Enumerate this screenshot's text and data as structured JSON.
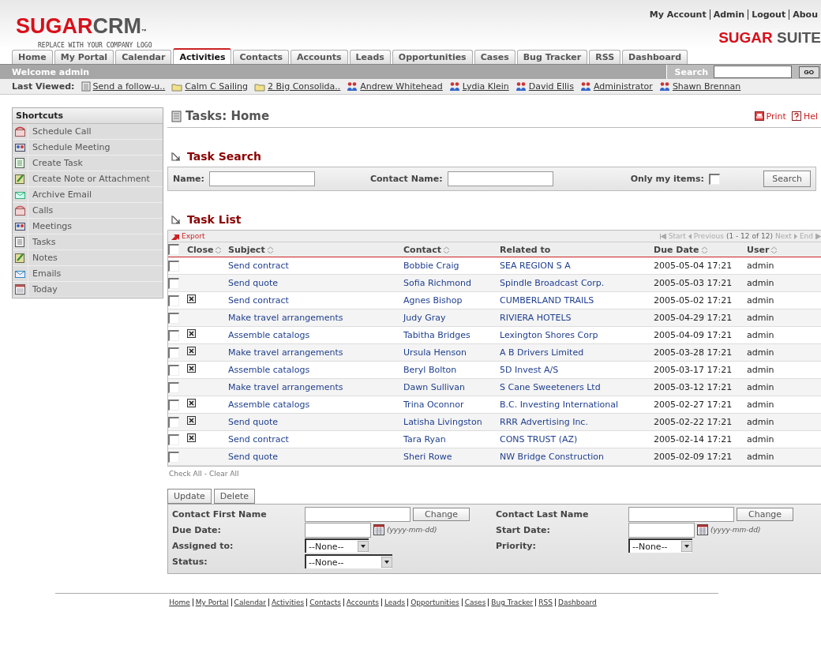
{
  "header": {
    "logo_main": "SUGAR",
    "logo_accent": "CRM",
    "logo_tm": "™",
    "logo_tagline": "REPLACE WITH YOUR COMPANY LOGO",
    "top_links": [
      "My Account",
      "Admin",
      "Logout",
      "Abou"
    ],
    "suite_logo_main": "SUGAR",
    "suite_logo_accent": "SUITE"
  },
  "tabs": [
    {
      "label": "Home",
      "selected": false
    },
    {
      "label": "My Portal",
      "selected": false
    },
    {
      "label": "Calendar",
      "selected": false
    },
    {
      "label": "Activities",
      "selected": true
    },
    {
      "label": "Contacts",
      "selected": false
    },
    {
      "label": "Accounts",
      "selected": false
    },
    {
      "label": "Leads",
      "selected": false
    },
    {
      "label": "Opportunities",
      "selected": false
    },
    {
      "label": "Cases",
      "selected": false
    },
    {
      "label": "Bug Tracker",
      "selected": false
    },
    {
      "label": "RSS",
      "selected": false
    },
    {
      "label": "Dashboard",
      "selected": false
    }
  ],
  "welcome_bar": {
    "text": "Welcome admin",
    "search_label": "Search",
    "go_button": "GO"
  },
  "last_viewed": {
    "label": "Last Viewed:",
    "items": [
      {
        "label": "Send a follow-u..",
        "kind": "task"
      },
      {
        "label": "Calm C Sailing",
        "kind": "account"
      },
      {
        "label": "2 Big Consolida..",
        "kind": "account"
      },
      {
        "label": "Andrew Whitehead",
        "kind": "contact"
      },
      {
        "label": "Lydia Klein",
        "kind": "contact"
      },
      {
        "label": "David Ellis",
        "kind": "contact"
      },
      {
        "label": "Administrator",
        "kind": "contact"
      },
      {
        "label": "Shawn Brennan",
        "kind": "contact"
      }
    ]
  },
  "sidebar": {
    "title": "Shortcuts",
    "items": [
      {
        "label": "Schedule Call",
        "kind": "call-new"
      },
      {
        "label": "Schedule Meeting",
        "kind": "meeting"
      },
      {
        "label": "Create Task",
        "kind": "task-new"
      },
      {
        "label": "Create Note or Attachment",
        "kind": "note"
      },
      {
        "label": "Archive Email",
        "kind": "email-new"
      },
      {
        "label": "Calls",
        "kind": "call"
      },
      {
        "label": "Meetings",
        "kind": "meeting"
      },
      {
        "label": "Tasks",
        "kind": "task"
      },
      {
        "label": "Notes",
        "kind": "note"
      },
      {
        "label": "Emails",
        "kind": "email"
      },
      {
        "label": "Today",
        "kind": "calendar"
      }
    ]
  },
  "page_title": "Tasks: Home",
  "print_link": "Print",
  "help_link": "Hel",
  "task_search": {
    "title": "Task Search",
    "name_label": "Name:",
    "contact_label": "Contact Name:",
    "only_mine_label": "Only my items:",
    "only_mine_checked": false,
    "search_button": "Search"
  },
  "task_list": {
    "title": "Task List",
    "export": "Export",
    "pagination": {
      "start": "Start",
      "previous": "Previous",
      "range": "(1 - 12 of 12)",
      "next": "Next",
      "end": "End"
    },
    "select_all_checked": false,
    "columns": [
      "Close",
      "Subject",
      "Contact",
      "Related to",
      "Due Date",
      "User"
    ],
    "rows": [
      {
        "checked": false,
        "closed": false,
        "subject": "Send contract",
        "contact": "Bobbie Craig",
        "related": "SEA REGION S A",
        "due": "2005-05-04 17:21",
        "user": "admin"
      },
      {
        "checked": false,
        "closed": false,
        "subject": "Send quote",
        "contact": "Sofia Richmond",
        "related": "Spindle Broadcast Corp.",
        "due": "2005-05-03 17:21",
        "user": "admin"
      },
      {
        "checked": false,
        "closed": true,
        "subject": "Send contract",
        "contact": "Agnes Bishop",
        "related": "CUMBERLAND TRAILS",
        "due": "2005-05-02 17:21",
        "user": "admin"
      },
      {
        "checked": false,
        "closed": false,
        "subject": "Make travel arrangements",
        "contact": "Judy Gray",
        "related": "RIVIERA HOTELS",
        "due": "2005-04-29 17:21",
        "user": "admin"
      },
      {
        "checked": false,
        "closed": true,
        "subject": "Assemble catalogs",
        "contact": "Tabitha Bridges",
        "related": "Lexington Shores Corp",
        "due": "2005-04-09 17:21",
        "user": "admin"
      },
      {
        "checked": false,
        "closed": true,
        "subject": "Make travel arrangements",
        "contact": "Ursula Henson",
        "related": "A B Drivers Limited",
        "due": "2005-03-28 17:21",
        "user": "admin"
      },
      {
        "checked": false,
        "closed": true,
        "subject": "Assemble catalogs",
        "contact": "Beryl Bolton",
        "related": "5D Invest A/S",
        "due": "2005-03-17 17:21",
        "user": "admin"
      },
      {
        "checked": false,
        "closed": false,
        "subject": "Make travel arrangements",
        "contact": "Dawn Sullivan",
        "related": "S Cane Sweeteners Ltd",
        "due": "2005-03-12 17:21",
        "user": "admin"
      },
      {
        "checked": false,
        "closed": true,
        "subject": "Assemble catalogs",
        "contact": "Trina Oconnor",
        "related": "B.C. Investing International",
        "due": "2005-02-27 17:21",
        "user": "admin"
      },
      {
        "checked": false,
        "closed": true,
        "subject": "Send quote",
        "contact": "Latisha Livingston",
        "related": "RRR Advertising Inc.",
        "due": "2005-02-22 17:21",
        "user": "admin"
      },
      {
        "checked": false,
        "closed": true,
        "subject": "Send contract",
        "contact": "Tara Ryan",
        "related": "CONS TRUST (AZ)",
        "due": "2005-02-14 17:21",
        "user": "admin"
      },
      {
        "checked": false,
        "closed": false,
        "subject": "Send quote",
        "contact": "Sheri Rowe",
        "related": "NW Bridge Construction",
        "due": "2005-02-09 17:21",
        "user": "admin"
      }
    ],
    "check_all": "Check All",
    "check_separator": "-",
    "clear_all": "Clear All"
  },
  "mass_update": {
    "buttons": [
      "Update",
      "Delete"
    ],
    "fields": [
      {
        "label": "Contact First Name",
        "kind": "change",
        "button": "Change"
      },
      {
        "label": "Contact Last Name",
        "kind": "change",
        "button": "Change"
      },
      {
        "label": "Due Date:",
        "kind": "date",
        "hint": "(yyyy-mm-dd)"
      },
      {
        "label": "Start Date:",
        "kind": "date",
        "hint": "(yyyy-mm-dd)"
      },
      {
        "label": "Assigned to:",
        "kind": "select",
        "value": "--None--"
      },
      {
        "label": "Priority:",
        "kind": "select",
        "value": "--None--"
      },
      {
        "label": "Status:",
        "kind": "select-wide",
        "value": "--None--"
      }
    ]
  },
  "footer_links": [
    "Home",
    "My Portal",
    "Calendar",
    "Activities",
    "Contacts",
    "Accounts",
    "Leads",
    "Opportunities",
    "Cases",
    "Bug Tracker",
    "RSS",
    "Dashboard"
  ]
}
